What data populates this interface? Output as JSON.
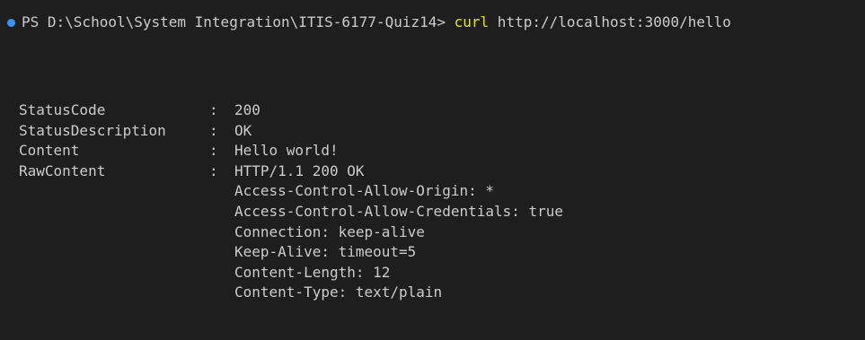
{
  "prompt": {
    "status_dot_color": "#3794ff",
    "prefix": "PS D:\\School\\System Integration\\ITIS-6177-Quiz14> ",
    "command": "curl",
    "command_color": "#e5e510",
    "args": " http://localhost:3000/hello"
  },
  "output": {
    "rows": [
      {
        "key": "StatusCode",
        "value": "200"
      },
      {
        "key": "StatusDescription",
        "value": "OK"
      },
      {
        "key": "Content",
        "value": "Hello world!"
      },
      {
        "key": "RawContent",
        "value": "HTTP/1.1 200 OK"
      }
    ],
    "raw_continuation": [
      "Access-Control-Allow-Origin: *",
      "Access-Control-Allow-Credentials: true",
      "Connection: keep-alive",
      "Keep-Alive: timeout=5",
      "Content-Length: 12",
      "Content-Type: text/plain"
    ],
    "separator": ":"
  },
  "colors": {
    "background": "#1e1e1e",
    "text": "#cccccc"
  }
}
